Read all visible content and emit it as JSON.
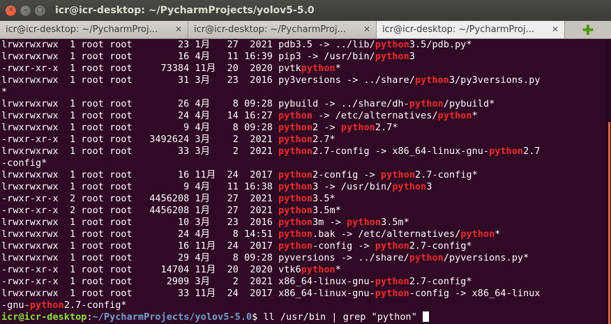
{
  "window": {
    "title": "icr@icr-desktop: ~/PycharmProjects/yolov5-5.0"
  },
  "tabs": [
    {
      "label": "icr@icr-desktop: ~/PycharmProj...",
      "active": false
    },
    {
      "label": "icr@icr-desktop: ~/PycharmProj...",
      "active": false
    },
    {
      "label": "icr@icr-desktop: ~/PycharmProj...",
      "active": true
    }
  ],
  "terminal": {
    "highlight_word": "python",
    "lines": [
      "lrwxrwxrwx  1 root root        23 1月   27  2021 pdb3.5 -> ../lib/python3.5/pdb.py*",
      "lrwxrwxrwx  1 root root        16 4月   11 16:39 pip3 -> /usr/bin/python3",
      "-rwxr-xr-x  1 root root     73384 11月  20  2020 pvtkpython*",
      "lrwxrwxrwx  1 root root        31 3月   23  2016 py3versions -> ../share/python3/py3versions.py",
      "*",
      "lrwxrwxrwx  1 root root        26 4月    8 09:28 pybuild -> ../share/dh-python/pybuild*",
      "lrwxrwxrwx  1 root root        24 4月   14 16:27 python -> /etc/alternatives/python*",
      "lrwxrwxrwx  1 root root         9 4月    8 09:28 python2 -> python2.7*",
      "-rwxr-xr-x  1 root root   3492624 3月    2  2021 python2.7*",
      "lrwxrwxrwx  1 root root        33 3月    2  2021 python2.7-config -> x86_64-linux-gnu-python2.7",
      "-config*",
      "lrwxrwxrwx  1 root root        16 11月  24  2017 python2-config -> python2.7-config*",
      "lrwxrwxrwx  1 root root         9 4月   11 16:38 python3 -> /usr/bin/python3",
      "-rwxr-xr-x  2 root root   4456208 1月   27  2021 python3.5*",
      "-rwxr-xr-x  2 root root   4456208 1月   27  2021 python3.5m*",
      "lrwxrwxrwx  1 root root        10 3月   23  2016 python3m -> python3.5m*",
      "lrwxrwxrwx  1 root root        24 4月    8 14:51 python.bak -> /etc/alternatives/python*",
      "lrwxrwxrwx  1 root root        16 11月  24  2017 python-config -> python2.7-config*",
      "lrwxrwxrwx  1 root root        29 4月    8 09:28 pyversions -> ../share/python/pyversions.py*",
      "-rwxr-xr-x  1 root root     14704 11月  20  2020 vtk6python*",
      "-rwxr-xr-x  1 root root      2909 3月    2  2021 x86_64-linux-gnu-python2.7-config*",
      "lrwxrwxrwx  1 root root        33 11月  24  2017 x86_64-linux-gnu-python-config -> x86_64-linux",
      "-gnu-python2.7-config*"
    ],
    "prompt": {
      "user_host": "icr@icr-desktop",
      "separator": ":",
      "path": "~/PycharmProjects/yolov5-5.0",
      "symbol": "$ ",
      "command": "ll /usr/bin | grep \"python\""
    }
  },
  "colors": {
    "background": "#300a24",
    "highlight": "#ef2929",
    "prompt_user": "#8ae234",
    "prompt_path": "#729fcf",
    "new_tab": "#4e9a06"
  },
  "icons": {
    "close": "close-icon",
    "minimize": "minimize-icon",
    "maximize": "maximize-icon",
    "new_tab": "plus-icon"
  }
}
